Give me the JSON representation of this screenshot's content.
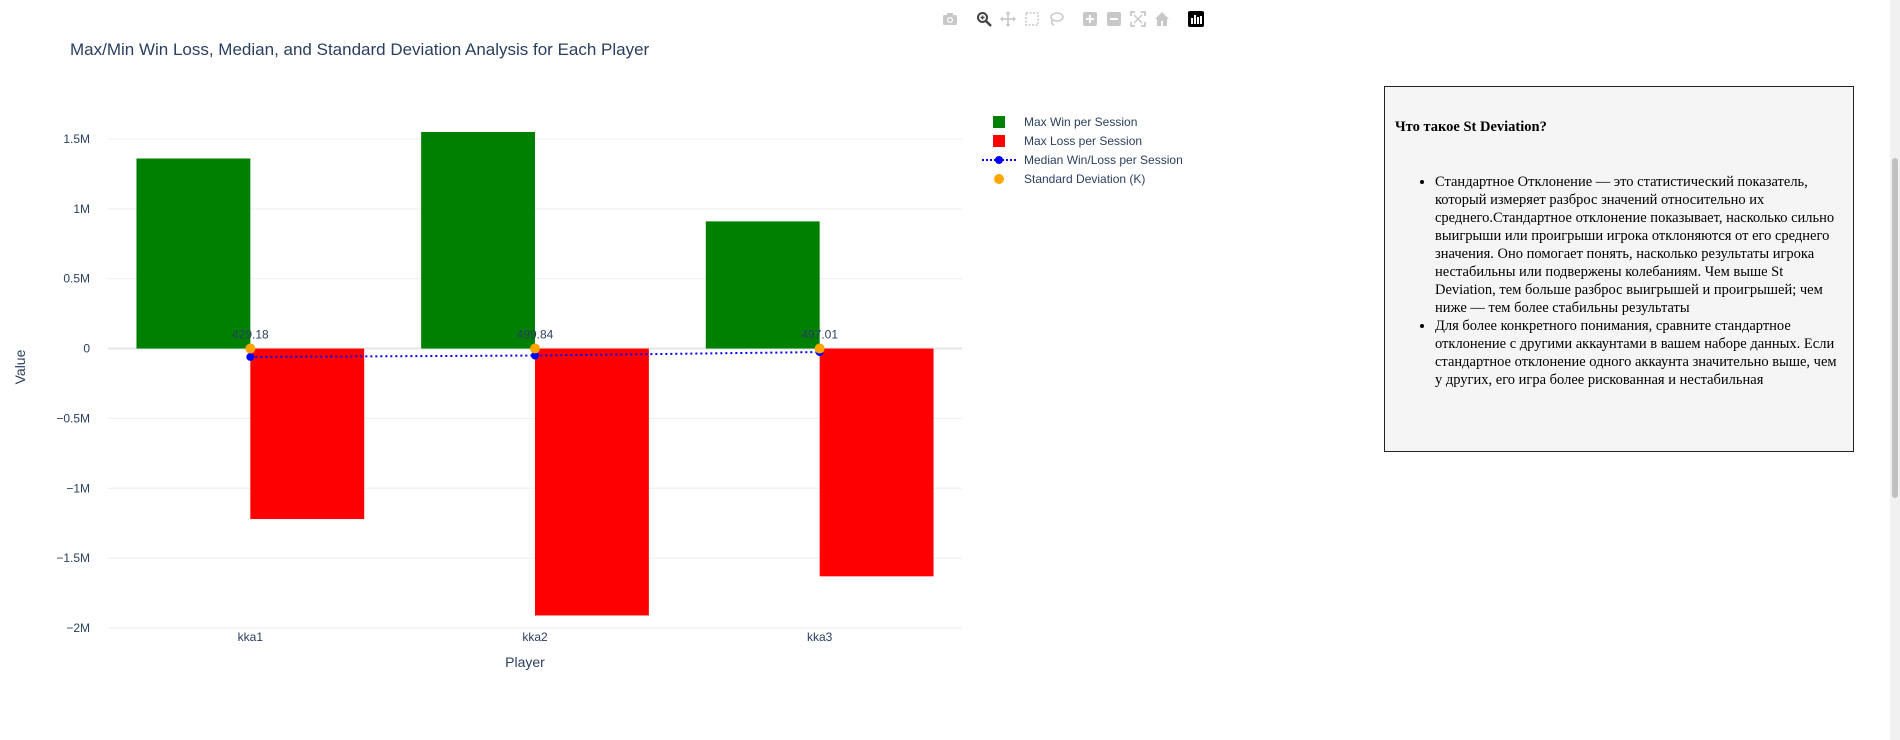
{
  "modebar": {
    "buttons": [
      "camera-icon",
      "zoom-icon",
      "pan-icon",
      "box-select-icon",
      "lasso-select-icon",
      "zoom-in-icon",
      "zoom-out-icon",
      "autoscale-icon",
      "reset-axes-icon",
      "plotly-logo-icon"
    ]
  },
  "chart_data": {
    "type": "bar",
    "title": "Max/Min Win Loss, Median, and Standard Deviation Analysis for Each Player",
    "xlabel": "Player",
    "ylabel": "Value",
    "categories": [
      "kka1",
      "kka2",
      "kka3"
    ],
    "ylim": [
      -2100000,
      1700000
    ],
    "yticks": [
      1500000,
      1000000,
      500000,
      0,
      -500000,
      -1000000,
      -1500000,
      -2000000
    ],
    "ytick_labels": [
      "1.5M",
      "1M",
      "0.5M",
      "0",
      "−0.5M",
      "−1M",
      "−1.5M",
      "−2M"
    ],
    "grid": true,
    "legend_position": "right",
    "series": [
      {
        "name": "Max Win per Session",
        "type": "bar",
        "color": "#008000",
        "values": [
          1360000,
          1550000,
          910000
        ]
      },
      {
        "name": "Max Loss per Session",
        "type": "bar",
        "color": "#ff0000",
        "values": [
          -1220000,
          -1910000,
          -1630000
        ]
      },
      {
        "name": "Median Win/Loss per Session",
        "type": "line",
        "style": "dotted",
        "color": "#0000ff",
        "values": [
          -60000,
          -50000,
          -25000
        ]
      },
      {
        "name": "Standard Deviation (K)",
        "type": "scatter",
        "color": "#ffa500",
        "values": [
          429.18,
          499.84,
          497.01
        ],
        "labels": [
          "429.18",
          "499.84",
          "497.01"
        ]
      }
    ]
  },
  "info": {
    "heading": "Что такое St Deviation?",
    "items": [
      "Стандартное Отклонение — это статистический показатель, который измеряет разброс значений относительно их среднего.Стандартное отклонение показывает, насколько сильно выигрыши или проигрыши игрока отклоняются от его среднего значения. Оно помогает понять, насколько результаты игрока нестабильны или подвержены колебаниям. Чем выше St Deviation, тем больше разброс выигрышей и проигрышей; чем ниже — тем более стабильны результаты",
      "Для более конкретного понимания, сравните стандартное отклонение с другими аккаунтами в вашем наборе данных. Если стандартное отклонение одного аккаунта значительно выше, чем у других, его игра более рискованная и нестабильная"
    ]
  }
}
